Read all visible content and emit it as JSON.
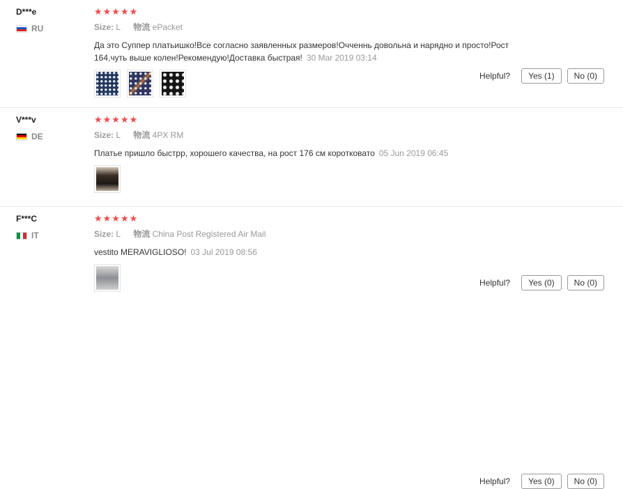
{
  "reviews": [
    {
      "user": "D***e",
      "country": "RU",
      "stars": "★★★★★",
      "size_label": "Size:",
      "size_value": "L",
      "shipping_label": "物流",
      "shipping_value": "ePacket",
      "text": "Да это Суппер платьишко!Все согласно заявленных размеров!Очченнь довольна и нарядно и просто!Рост 164,чуть выше колен!Рекомендую!Доставка быстрая!",
      "date": "30 Mar 2019 03:14",
      "helpful_label": "Helpful?",
      "yes_label": "Yes (1)",
      "no_label": "No (0)"
    },
    {
      "user": "V***v",
      "country": "DE",
      "stars": "★★★★★",
      "size_label": "Size:",
      "size_value": "L",
      "shipping_label": "物流",
      "shipping_value": "4PX RM",
      "text": "Платье пришло быстрр, хорошего качества, на рост 176 см коротковато",
      "date": "05 Jun 2019 06:45",
      "helpful_label": "Helpful?",
      "yes_label": "Yes (0)",
      "no_label": "No (0)"
    },
    {
      "user": "F***C",
      "country": "IT",
      "stars": "★★★★★",
      "size_label": "Size:",
      "size_value": "L",
      "shipping_label": "物流",
      "shipping_value": "China Post Registered Air Mail",
      "text": "vestito MERAVIGLIOSO!",
      "date": "03 Jul 2019 08:56",
      "helpful_label": "Helpful?",
      "yes_label": "Yes (0)",
      "no_label": "No (0)"
    }
  ],
  "colors": {
    "star": "#f04b4b",
    "muted": "#999999",
    "text": "#333333"
  },
  "icons": {
    "star": "star-icon",
    "flags": [
      "flag-ru-icon",
      "flag-de-icon",
      "flag-it-icon"
    ]
  }
}
